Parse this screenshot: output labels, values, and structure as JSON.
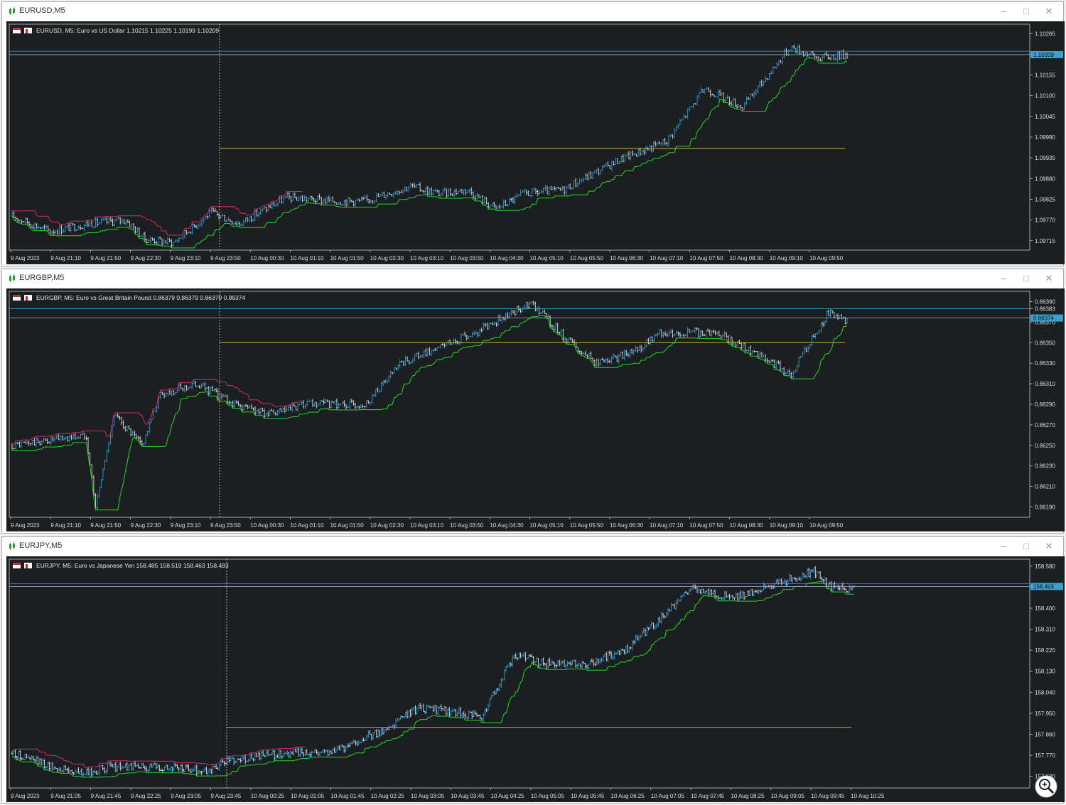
{
  "colors": {
    "background": "#1c1f22",
    "grid_frame": "#c8c8c8",
    "bull": "#2e9bd6",
    "bear": "#dcdcdc",
    "support": "#1fdc1f",
    "resistance": "#d02a70",
    "level": "#c8b43a",
    "price_line": "#3aa0d0",
    "price_label": "#3aa0d0"
  },
  "windows": [
    {
      "title": "EURUSD,M5",
      "header": "EURUSD, M5:  Euro vs US Dollar  1.10215 1.10225 1.10199 1.10209",
      "price_axis": [
        "1.10265",
        "1.10209",
        "1.10155",
        "1.10100",
        "1.10045",
        "1.09990",
        "1.09935",
        "1.09880",
        "1.09825",
        "1.09770",
        "1.09715"
      ],
      "price_label": "1.10209",
      "time_axis": [
        "9 Aug 2023",
        "9 Aug 21:10",
        "9 Aug 21:50",
        "9 Aug 22:30",
        "9 Aug 23:10",
        "9 Aug 23:50",
        "10 Aug 00:30",
        "10 Aug 01:10",
        "10 Aug 01:50",
        "10 Aug 02:30",
        "10 Aug 03:10",
        "10 Aug 03:50",
        "10 Aug 04:30",
        "10 Aug 05:10",
        "10 Aug 05:50",
        "10 Aug 06:30",
        "10 Aug 07:10",
        "10 Aug 07:50",
        "10 Aug 08:30",
        "10 Aug 09:10",
        "10 Aug 09:50"
      ]
    },
    {
      "title": "EURGBP,M5",
      "header": "EURGBP, M5:  Euro vs Great Britain Pound  0.86379 0.86379 0.86370 0.86374",
      "price_axis": [
        "0.86390",
        "0.86383",
        "0.86374",
        "0.86370",
        "0.86350",
        "0.86330",
        "0.86310",
        "0.86290",
        "0.86270",
        "0.86250",
        "0.86230",
        "0.86210",
        "0.86190"
      ],
      "price_label": "0.86374",
      "time_axis": [
        "9 Aug 2023",
        "9 Aug 21:10",
        "9 Aug 21:50",
        "9 Aug 22:30",
        "9 Aug 23:10",
        "9 Aug 23:50",
        "10 Aug 00:30",
        "10 Aug 01:10",
        "10 Aug 01:50",
        "10 Aug 02:30",
        "10 Aug 03:10",
        "10 Aug 03:50",
        "10 Aug 04:30",
        "10 Aug 05:10",
        "10 Aug 05:50",
        "10 Aug 06:30",
        "10 Aug 07:10",
        "10 Aug 07:50",
        "10 Aug 08:30",
        "10 Aug 09:10",
        "10 Aug 09:50"
      ]
    },
    {
      "title": "EURJPY,M5",
      "header": "EURJPY, M5:  Euro vs Japanese Yen  158.485 158.519 158.463 158.493",
      "price_axis": [
        "158.580",
        "158.493",
        "158.400",
        "158.310",
        "158.220",
        "158.130",
        "158.040",
        "157.950",
        "157.860",
        "157.770",
        "157.680"
      ],
      "price_label": "158.493",
      "time_axis": [
        "9 Aug 2023",
        "9 Aug 21:05",
        "9 Aug 21:45",
        "9 Aug 22:25",
        "9 Aug 23:05",
        "9 Aug 23:45",
        "10 Aug 00:25",
        "10 Aug 01:05",
        "10 Aug 01:45",
        "10 Aug 02:25",
        "10 Aug 03:05",
        "10 Aug 03:45",
        "10 Aug 04:25",
        "10 Aug 05:05",
        "10 Aug 05:45",
        "10 Aug 06:25",
        "10 Aug 07:05",
        "10 Aug 07:45",
        "10 Aug 08:25",
        "10 Aug 09:05",
        "10 Aug 09:45",
        "10 Aug 10:25"
      ]
    }
  ],
  "chart_data": [
    {
      "type": "candlestick",
      "symbol": "EURUSD",
      "timeframe": "M5",
      "ohlc_last": {
        "open": 1.10215,
        "high": 1.10225,
        "low": 1.10199,
        "close": 1.10209
      },
      "ylim": [
        1.0969,
        1.1029
      ],
      "horizontal_level": 1.0996,
      "price_lines": [
        1.10209,
        1.10218
      ],
      "anchors": [
        [
          0,
          1.0978
        ],
        [
          20,
          1.0974
        ],
        [
          40,
          1.0976
        ],
        [
          60,
          1.0977
        ],
        [
          70,
          1.0972
        ],
        [
          85,
          1.0971
        ],
        [
          105,
          1.0979
        ],
        [
          120,
          1.0976
        ],
        [
          130,
          1.0979
        ],
        [
          145,
          1.0983
        ],
        [
          170,
          1.0982
        ],
        [
          185,
          1.0982
        ],
        [
          210,
          1.0986
        ],
        [
          225,
          1.0984
        ],
        [
          240,
          1.0985
        ],
        [
          255,
          1.098
        ],
        [
          270,
          1.0984
        ],
        [
          290,
          1.0985
        ],
        [
          320,
          1.0993
        ],
        [
          345,
          1.0998
        ],
        [
          365,
          1.1012
        ],
        [
          385,
          1.1007
        ],
        [
          410,
          1.1023
        ],
        [
          425,
          1.102
        ],
        [
          440,
          1.1021
        ]
      ]
    },
    {
      "type": "candlestick",
      "symbol": "EURGBP",
      "timeframe": "M5",
      "ohlc_last": {
        "open": 0.86379,
        "high": 0.86379,
        "low": 0.8637,
        "close": 0.86374
      },
      "ylim": [
        0.8618,
        0.864
      ],
      "horizontal_level": 0.8635,
      "price_lines": [
        0.86374,
        0.86383
      ],
      "anchors": [
        [
          0,
          0.8625
        ],
        [
          40,
          0.8626
        ],
        [
          45,
          0.8619
        ],
        [
          55,
          0.8628
        ],
        [
          70,
          0.8625
        ],
        [
          80,
          0.863
        ],
        [
          100,
          0.8631
        ],
        [
          120,
          0.8629
        ],
        [
          140,
          0.8628
        ],
        [
          160,
          0.8629
        ],
        [
          190,
          0.8629
        ],
        [
          210,
          0.8633
        ],
        [
          250,
          0.8636
        ],
        [
          280,
          0.8639
        ],
        [
          295,
          0.8636
        ],
        [
          315,
          0.8633
        ],
        [
          335,
          0.8634
        ],
        [
          350,
          0.8636
        ],
        [
          380,
          0.8636
        ],
        [
          400,
          0.8634
        ],
        [
          420,
          0.8632
        ],
        [
          440,
          0.8638
        ],
        [
          450,
          0.8637
        ]
      ]
    },
    {
      "type": "candlestick",
      "symbol": "EURJPY",
      "timeframe": "M5",
      "ohlc_last": {
        "open": 158.485,
        "high": 158.519,
        "low": 158.463,
        "close": 158.493
      },
      "ylim": [
        157.63,
        158.61
      ],
      "horizontal_level": 157.89,
      "price_lines": [
        158.493,
        158.505
      ],
      "anchors": [
        [
          0,
          157.78
        ],
        [
          25,
          157.72
        ],
        [
          45,
          157.69
        ],
        [
          60,
          157.72
        ],
        [
          95,
          157.72
        ],
        [
          120,
          157.7
        ],
        [
          135,
          157.75
        ],
        [
          170,
          157.78
        ],
        [
          200,
          157.79
        ],
        [
          230,
          157.88
        ],
        [
          250,
          157.97
        ],
        [
          270,
          157.96
        ],
        [
          290,
          157.93
        ],
        [
          310,
          158.2
        ],
        [
          330,
          158.16
        ],
        [
          355,
          158.16
        ],
        [
          380,
          158.23
        ],
        [
          395,
          158.32
        ],
        [
          420,
          158.49
        ],
        [
          445,
          158.44
        ],
        [
          470,
          158.5
        ],
        [
          495,
          158.56
        ],
        [
          505,
          158.49
        ],
        [
          520,
          158.48
        ]
      ]
    }
  ]
}
